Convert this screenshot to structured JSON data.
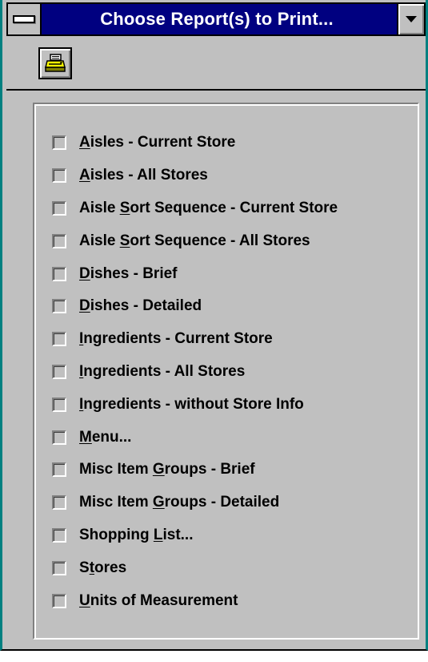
{
  "window": {
    "title": "Choose Report(s) to Print..."
  },
  "toolbar": {
    "print_icon": "printer-icon"
  },
  "reports": [
    {
      "pre": "",
      "key": "A",
      "post": "isles - Current Store",
      "checked": false
    },
    {
      "pre": "",
      "key": "A",
      "post": "isles - All Stores",
      "checked": false
    },
    {
      "pre": "Aisle ",
      "key": "S",
      "post": "ort Sequence - Current Store",
      "checked": false
    },
    {
      "pre": "Aisle ",
      "key": "S",
      "post": "ort Sequence - All Stores",
      "checked": false
    },
    {
      "pre": "",
      "key": "D",
      "post": "ishes - Brief",
      "checked": false
    },
    {
      "pre": "",
      "key": "D",
      "post": "ishes - Detailed",
      "checked": false
    },
    {
      "pre": "",
      "key": "I",
      "post": "ngredients - Current Store",
      "checked": false
    },
    {
      "pre": "",
      "key": "I",
      "post": "ngredients - All Stores",
      "checked": false
    },
    {
      "pre": "",
      "key": "I",
      "post": "ngredients - without Store Info",
      "checked": false
    },
    {
      "pre": "",
      "key": "M",
      "post": "enu...",
      "checked": false
    },
    {
      "pre": "Misc Item ",
      "key": "G",
      "post": "roups - Brief",
      "checked": false
    },
    {
      "pre": "Misc Item ",
      "key": "G",
      "post": "roups - Detailed",
      "checked": false
    },
    {
      "pre": "Shopping ",
      "key": "L",
      "post": "ist...",
      "checked": false
    },
    {
      "pre": "S",
      "key": "t",
      "post": "ores",
      "checked": false
    },
    {
      "pre": "",
      "key": "U",
      "post": "nits of Measurement",
      "checked": false
    }
  ]
}
